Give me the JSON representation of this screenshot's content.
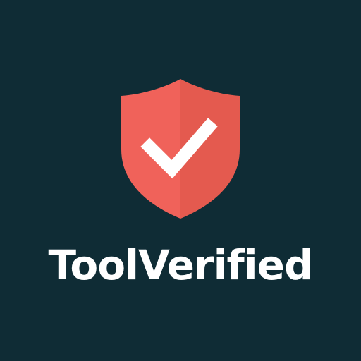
{
  "logo": {
    "brand_name": "ToolVerified",
    "icon": "shield-check-icon",
    "colors": {
      "background": "#0f2c35",
      "shield_left": "#f0625a",
      "shield_right": "#e45a4f",
      "check": "#ffffff",
      "text": "#ffffff"
    }
  }
}
